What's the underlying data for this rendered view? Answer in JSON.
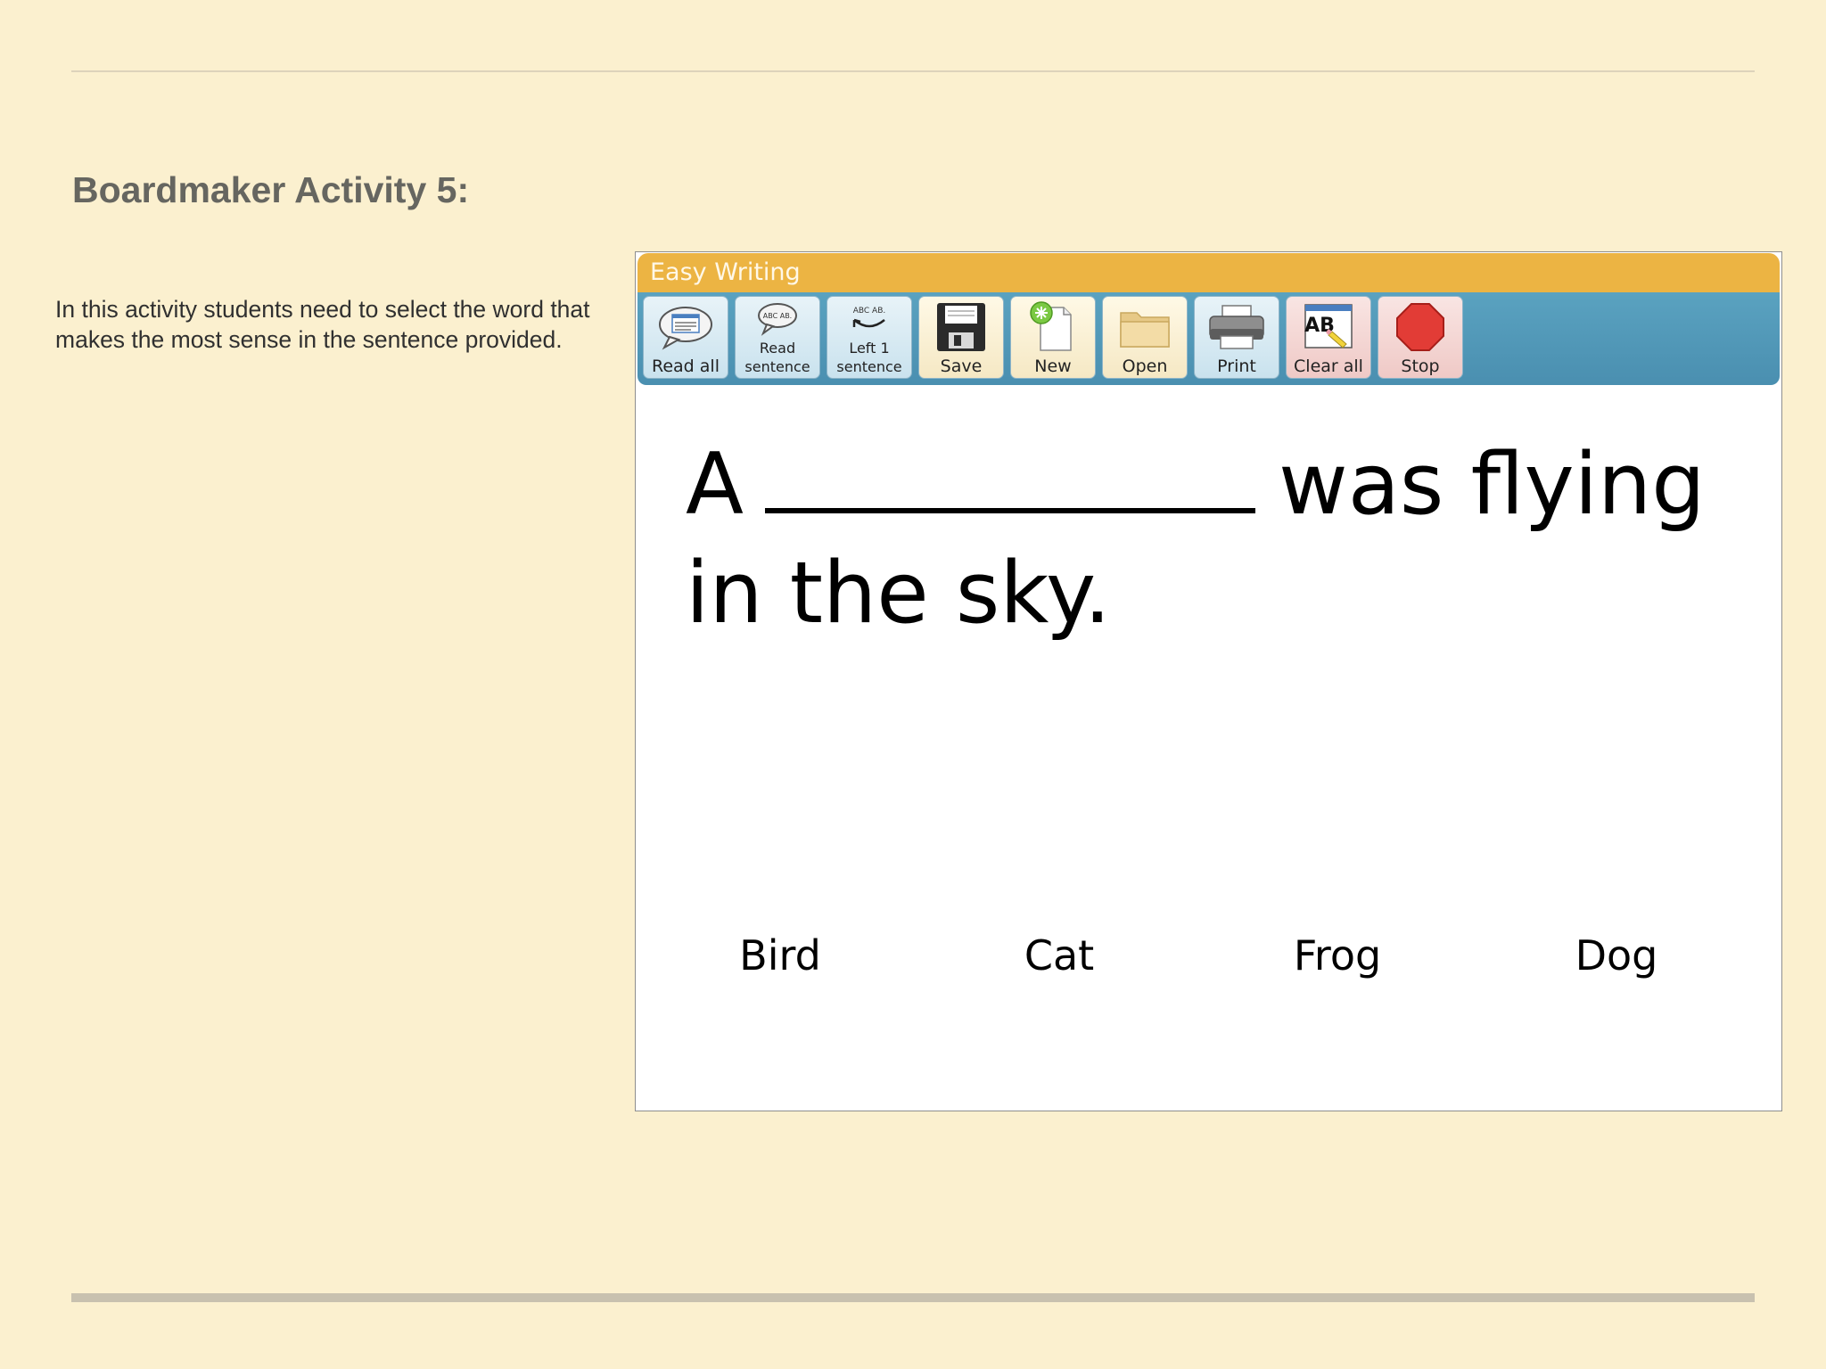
{
  "slide": {
    "title": "Boardmaker Activity 5:",
    "description": "In this activity students need to select the word that makes the most sense in the sentence provided."
  },
  "app": {
    "title": "Easy Writing",
    "colors": {
      "titlebar": "#ecb443",
      "toolbar": "#4f98b8"
    },
    "toolbar": [
      {
        "id": "read-all",
        "line1": "Read all",
        "icon": "speech-bubble-icon"
      },
      {
        "id": "read-sentence",
        "line1": "Read",
        "line2": "sentence",
        "icon_text": "ABC AB.",
        "icon": "speech-bubble-icon"
      },
      {
        "id": "left-1-sentence",
        "line1": "Left 1",
        "line2": "sentence",
        "icon_text": "ABC AB.",
        "icon": "arrow-left-curve-icon"
      },
      {
        "id": "save",
        "line1": "Save",
        "icon": "floppy-disk-icon"
      },
      {
        "id": "new",
        "line1": "New",
        "icon": "new-document-icon"
      },
      {
        "id": "open",
        "line1": "Open",
        "icon": "folder-icon"
      },
      {
        "id": "print",
        "line1": "Print",
        "icon": "printer-icon"
      },
      {
        "id": "clear-all",
        "line1": "Clear all",
        "icon_text": "AB",
        "icon": "clear-eraser-icon"
      },
      {
        "id": "stop",
        "line1": "Stop",
        "icon": "stop-sign-icon"
      }
    ],
    "sentence": {
      "before": "A",
      "after": "was flying in the sky."
    },
    "choices": [
      "Bird",
      "Cat",
      "Frog",
      "Dog"
    ]
  }
}
